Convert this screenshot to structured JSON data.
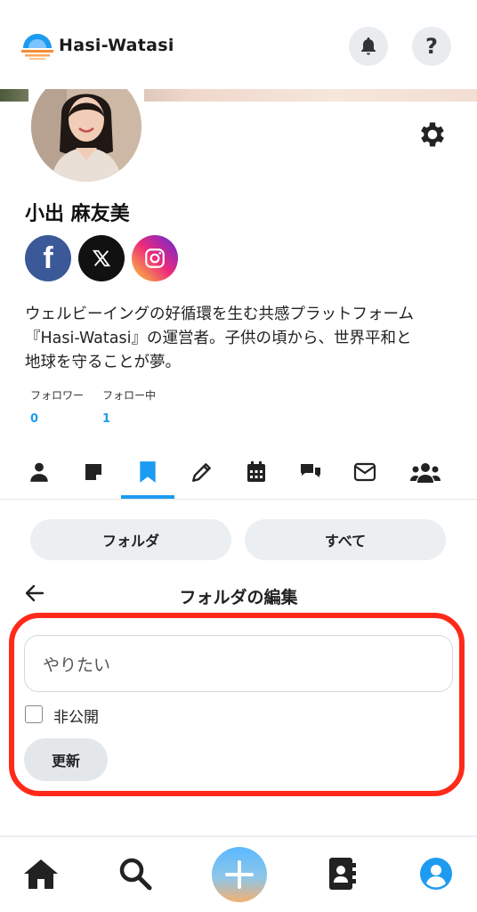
{
  "header": {
    "brand": "Hasi-Watasi",
    "bell_icon": "bell-icon",
    "help_label": "?"
  },
  "profile": {
    "name": "小出 麻友美",
    "bio_line1": "ウェルビーイングの好循環を生む共感プラットフォーム",
    "bio_line2": "『Hasi-Watasi』の運営者。子供の頃から、世界平和と",
    "bio_line3": "地球を守ることが夢。",
    "followers_label": "フォロワー",
    "followers_count": "0",
    "following_label": "フォロー中",
    "following_count": "1"
  },
  "social": [
    "facebook-icon",
    "x-icon",
    "instagram-icon"
  ],
  "tabs": [
    "profile-icon",
    "note-icon",
    "bookmark-icon",
    "pencil-icon",
    "calendar-icon",
    "chat-icon",
    "envelope-icon",
    "group-icon"
  ],
  "active_tab": "bookmark-icon",
  "filters": {
    "folder": "フォルダ",
    "all": "すべて"
  },
  "edit": {
    "title": "フォルダの編集",
    "folder_name_value": "やりたい",
    "private_label": "非公開",
    "private_checked": false,
    "update_label": "更新"
  },
  "bottom_nav": [
    "home-icon",
    "search-icon",
    "plus-icon",
    "contacts-icon",
    "account-icon"
  ],
  "colors": {
    "accent": "#1d9bf0",
    "highlight": "#ff2a1a",
    "facebook": "#3b5998"
  }
}
